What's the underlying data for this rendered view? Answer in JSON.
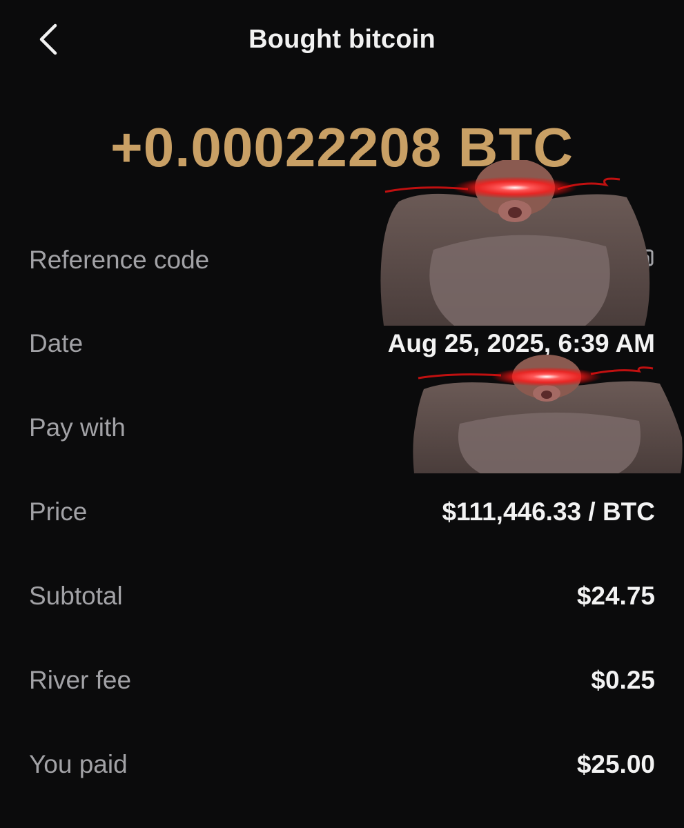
{
  "header": {
    "back_icon": "chevron-left-icon",
    "title": "Bought bitcoin"
  },
  "amount": "+0.00022208 BTC",
  "colors": {
    "background": "#0b0b0c",
    "amount_gold": "#c9a065",
    "label_gray": "#a2a2a6",
    "value_white": "#f3f3f3",
    "eye_glow_red": "#ff1a1a"
  },
  "details": {
    "reference_code": {
      "label": "Reference code",
      "icon": "copy-icon"
    },
    "date": {
      "label": "Date",
      "value": "Aug 25, 2025, 6:39 AM"
    },
    "pay_with": {
      "label": "Pay with"
    },
    "price": {
      "label": "Price",
      "value": "$111,446.33 / BTC"
    },
    "subtotal": {
      "label": "Subtotal",
      "value": "$24.75"
    },
    "river_fee": {
      "label": "River fee",
      "value": "$0.25"
    },
    "you_paid": {
      "label": "You paid",
      "value": "$25.00"
    }
  },
  "overlays": [
    {
      "name": "glowing-eyes-ape-sticker"
    },
    {
      "name": "glowing-eyes-ape-sticker"
    }
  ]
}
